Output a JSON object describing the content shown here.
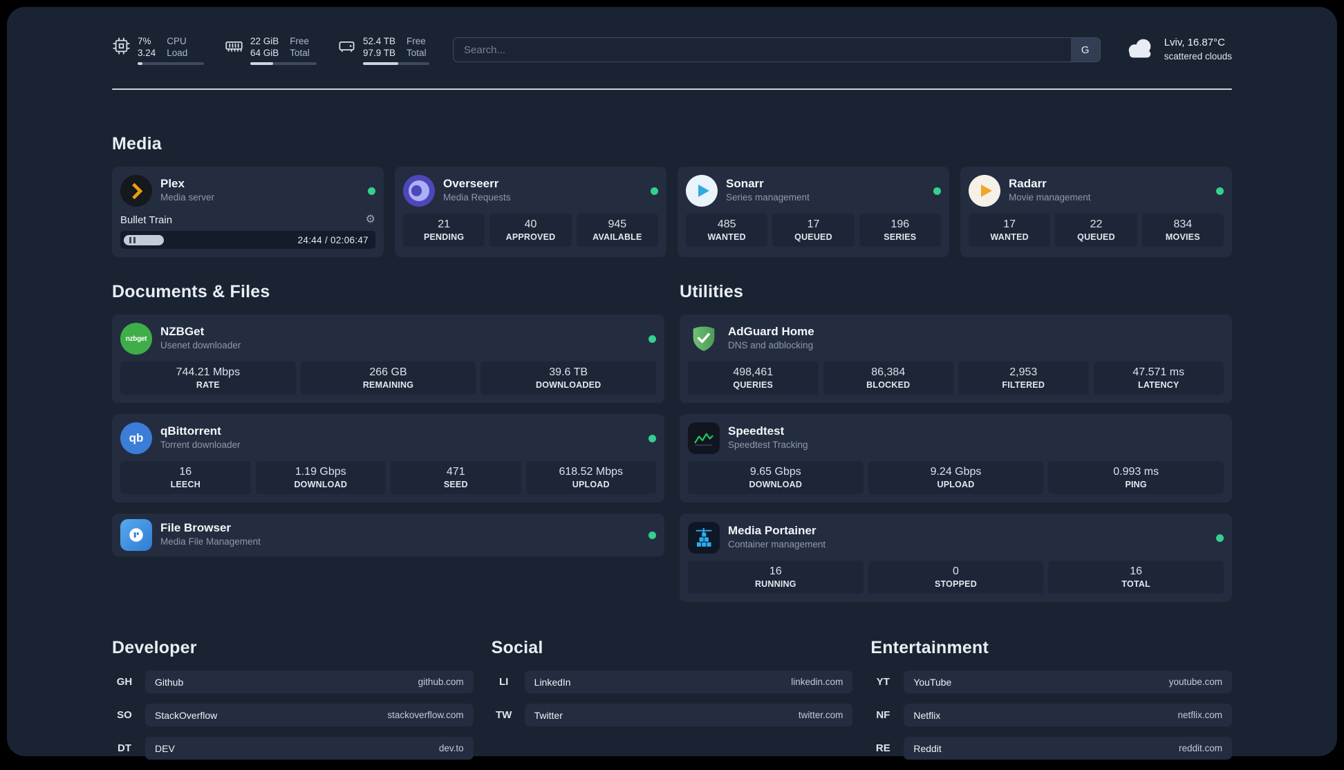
{
  "colors": {
    "status_green": "#35d08e",
    "plex_amber": "#e5a00d",
    "overseerr_purple": "#4f46ba",
    "sonarr_blue": "#35a8e0",
    "radarr_amber": "#f2a528",
    "nzbget_green": "#3fae49",
    "qbittorrent_blue": "#3b7dd8",
    "filebrowser_blue": "#2e7cd6",
    "adguard_green": "#5fae66",
    "speedtest_green": "#22c55e",
    "portainer_blue": "#29aef3"
  },
  "topbar": {
    "cpu": {
      "value_top": "7%",
      "value_bottom": "3.24",
      "label_top": "CPU",
      "label_bottom": "Load",
      "percent": 7
    },
    "ram": {
      "value_top": "22 GiB",
      "value_bottom": "64 GiB",
      "label_top": "Free",
      "label_bottom": "Total",
      "percent": 34
    },
    "disk": {
      "value_top": "52.4 TB",
      "value_bottom": "97.9 TB",
      "label_top": "Free",
      "label_bottom": "Total",
      "percent": 53
    },
    "search": {
      "placeholder": "Search...",
      "engine": "G"
    },
    "weather": {
      "location": "Lviv, 16.87°C",
      "condition": "scattered clouds"
    }
  },
  "media": {
    "title": "Media",
    "plex": {
      "name": "Plex",
      "subtitle": "Media server",
      "icon": "plex-icon",
      "now_playing": "Bullet Train",
      "time": "24:44 / 02:06:47"
    },
    "overseerr": {
      "name": "Overseerr",
      "subtitle": "Media Requests",
      "icon": "overseerr-icon",
      "stats": [
        {
          "value": "21",
          "label": "PENDING"
        },
        {
          "value": "40",
          "label": "APPROVED"
        },
        {
          "value": "945",
          "label": "AVAILABLE"
        }
      ]
    },
    "sonarr": {
      "name": "Sonarr",
      "subtitle": "Series management",
      "icon": "sonarr-icon",
      "stats": [
        {
          "value": "485",
          "label": "WANTED"
        },
        {
          "value": "17",
          "label": "QUEUED"
        },
        {
          "value": "196",
          "label": "SERIES"
        }
      ]
    },
    "radarr": {
      "name": "Radarr",
      "subtitle": "Movie management",
      "icon": "radarr-icon",
      "stats": [
        {
          "value": "17",
          "label": "WANTED"
        },
        {
          "value": "22",
          "label": "QUEUED"
        },
        {
          "value": "834",
          "label": "MOVIES"
        }
      ]
    }
  },
  "documents": {
    "title": "Documents & Files",
    "nzbget": {
      "name": "NZBGet",
      "subtitle": "Usenet downloader",
      "icon": "nzbget-icon",
      "icon_text": "nzbget",
      "stats": [
        {
          "value": "744.21 Mbps",
          "label": "RATE"
        },
        {
          "value": "266 GB",
          "label": "REMAINING"
        },
        {
          "value": "39.6 TB",
          "label": "DOWNLOADED"
        }
      ]
    },
    "qbittorrent": {
      "name": "qBittorrent",
      "subtitle": "Torrent downloader",
      "icon": "qbittorrent-icon",
      "icon_text": "qb",
      "stats": [
        {
          "value": "16",
          "label": "LEECH"
        },
        {
          "value": "1.19 Gbps",
          "label": "DOWNLOAD"
        },
        {
          "value": "471",
          "label": "SEED"
        },
        {
          "value": "618.52 Mbps",
          "label": "UPLOAD"
        }
      ]
    },
    "filebrowser": {
      "name": "File Browser",
      "subtitle": "Media File Management",
      "icon": "filebrowser-icon"
    }
  },
  "utilities": {
    "title": "Utilities",
    "adguard": {
      "name": "AdGuard Home",
      "subtitle": "DNS and adblocking",
      "icon": "adguard-shield-icon",
      "stats": [
        {
          "value": "498,461",
          "label": "QUERIES"
        },
        {
          "value": "86,384",
          "label": "BLOCKED"
        },
        {
          "value": "2,953",
          "label": "FILTERED"
        },
        {
          "value": "47.571 ms",
          "label": "LATENCY"
        }
      ]
    },
    "speedtest": {
      "name": "Speedtest",
      "subtitle": "Speedtest Tracking",
      "icon": "speedtest-chart-icon",
      "stats": [
        {
          "value": "9.65 Gbps",
          "label": "DOWNLOAD"
        },
        {
          "value": "9.24 Gbps",
          "label": "UPLOAD"
        },
        {
          "value": "0.993 ms",
          "label": "PING"
        }
      ]
    },
    "portainer": {
      "name": "Media Portainer",
      "subtitle": "Container management",
      "icon": "portainer-icon",
      "stats": [
        {
          "value": "16",
          "label": "RUNNING"
        },
        {
          "value": "0",
          "label": "STOPPED"
        },
        {
          "value": "16",
          "label": "TOTAL"
        }
      ]
    }
  },
  "bookmarks": {
    "developer": {
      "title": "Developer",
      "items": [
        {
          "abbr": "GH",
          "name": "Github",
          "url": "github.com"
        },
        {
          "abbr": "SO",
          "name": "StackOverflow",
          "url": "stackoverflow.com"
        },
        {
          "abbr": "DT",
          "name": "DEV",
          "url": "dev.to"
        }
      ]
    },
    "social": {
      "title": "Social",
      "items": [
        {
          "abbr": "LI",
          "name": "LinkedIn",
          "url": "linkedin.com"
        },
        {
          "abbr": "TW",
          "name": "Twitter",
          "url": "twitter.com"
        }
      ]
    },
    "entertainment": {
      "title": "Entertainment",
      "items": [
        {
          "abbr": "YT",
          "name": "YouTube",
          "url": "youtube.com"
        },
        {
          "abbr": "NF",
          "name": "Netflix",
          "url": "netflix.com"
        },
        {
          "abbr": "RE",
          "name": "Reddit",
          "url": "reddit.com"
        }
      ]
    }
  }
}
